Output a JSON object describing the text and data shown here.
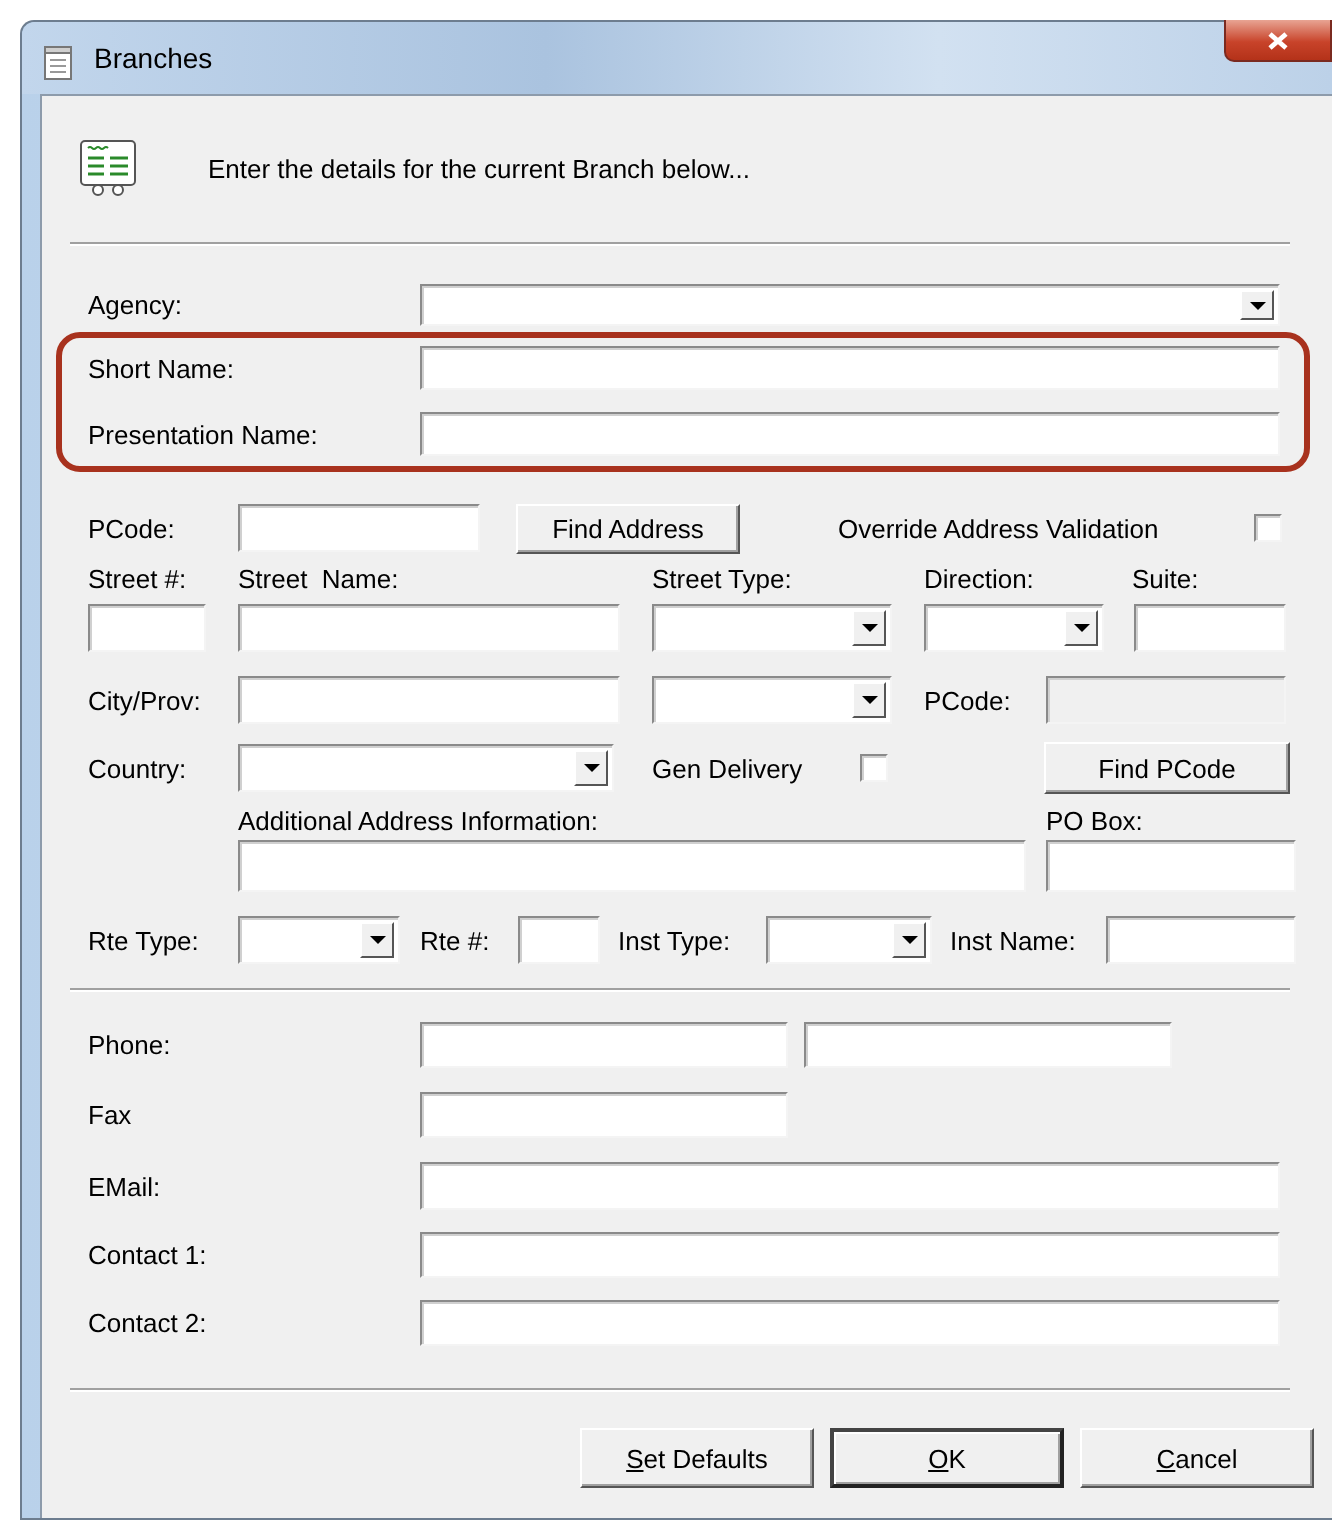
{
  "window": {
    "title": "Branches"
  },
  "header": {
    "text": "Enter the details for the current Branch below..."
  },
  "sections": [
    {
      "rows": [
        {
          "highlighted": false,
          "items": [
            {
              "kind": "label",
              "text": "Agency:"
            },
            {
              "kind": "combo"
            }
          ]
        },
        {
          "highlighted": true,
          "items": [
            {
              "kind": "label",
              "text": "Short Name:"
            },
            {
              "kind": "field"
            }
          ]
        },
        {
          "highlighted": true,
          "items": [
            {
              "kind": "label",
              "text": "Presentation Name:"
            },
            {
              "kind": "field"
            }
          ]
        },
        {
          "highlighted": false,
          "items": [
            {
              "kind": "label",
              "text": "PCode:"
            },
            {
              "kind": "field"
            },
            {
              "kind": "button",
              "text": "Find Address"
            },
            {
              "kind": "label",
              "text": "Override Address Validation"
            },
            {
              "kind": "checkbox",
              "checked": false
            }
          ]
        },
        {
          "highlighted": false,
          "items": [
            {
              "kind": "label",
              "text": "Street #:"
            },
            {
              "kind": "label",
              "text": "Street  Name:"
            },
            {
              "kind": "label",
              "text": "Street Type:"
            },
            {
              "kind": "label",
              "text": "Direction:"
            },
            {
              "kind": "label",
              "text": "Suite:"
            }
          ]
        },
        {
          "highlighted": false,
          "items": [
            {
              "kind": "field"
            },
            {
              "kind": "field"
            },
            {
              "kind": "combo"
            },
            {
              "kind": "combo"
            },
            {
              "kind": "field"
            }
          ]
        },
        {
          "highlighted": false,
          "items": [
            {
              "kind": "label",
              "text": "City/Prov:"
            },
            {
              "kind": "field"
            },
            {
              "kind": "combo"
            },
            {
              "kind": "label",
              "text": "PCode:"
            },
            {
              "kind": "field",
              "disabled": true
            }
          ]
        },
        {
          "highlighted": false,
          "items": [
            {
              "kind": "label",
              "text": "Country:"
            },
            {
              "kind": "combo"
            },
            {
              "kind": "label",
              "text": "Gen Delivery"
            },
            {
              "kind": "checkbox",
              "checked": false
            },
            {
              "kind": "button",
              "text": "Find PCode"
            }
          ]
        },
        {
          "highlighted": false,
          "items": [
            {
              "kind": "label",
              "text": "Additional Address Information:"
            },
            {
              "kind": "label",
              "text": "PO Box:"
            }
          ]
        },
        {
          "highlighted": false,
          "items": [
            {
              "kind": "field"
            },
            {
              "kind": "field"
            }
          ]
        },
        {
          "highlighted": false,
          "items": [
            {
              "kind": "label",
              "text": "Rte Type:"
            },
            {
              "kind": "combo"
            },
            {
              "kind": "label",
              "text": "Rte #:"
            },
            {
              "kind": "field"
            },
            {
              "kind": "label",
              "text": "Inst Type:"
            },
            {
              "kind": "combo"
            },
            {
              "kind": "label",
              "text": "Inst Name:"
            },
            {
              "kind": "field"
            }
          ]
        }
      ]
    },
    {
      "rows": [
        {
          "highlighted": false,
          "items": [
            {
              "kind": "label",
              "text": "Phone:"
            },
            {
              "kind": "field"
            },
            {
              "kind": "field"
            }
          ]
        },
        {
          "highlighted": false,
          "items": [
            {
              "kind": "label",
              "text": "Fax"
            },
            {
              "kind": "field"
            }
          ]
        },
        {
          "highlighted": false,
          "items": [
            {
              "kind": "label",
              "text": "EMail:"
            },
            {
              "kind": "field"
            }
          ]
        },
        {
          "highlighted": false,
          "items": [
            {
              "kind": "label",
              "text": "Contact 1:"
            },
            {
              "kind": "field"
            }
          ]
        },
        {
          "highlighted": false,
          "items": [
            {
              "kind": "label",
              "text": "Contact 2:"
            },
            {
              "kind": "field"
            }
          ]
        }
      ]
    }
  ],
  "buttons": [
    {
      "text": "Set Defaults",
      "default": false,
      "access_key_shown": true
    },
    {
      "text": "OK",
      "default": true,
      "access_key_shown": true
    },
    {
      "text": "Cancel",
      "default": false,
      "access_key_shown": true
    }
  ]
}
